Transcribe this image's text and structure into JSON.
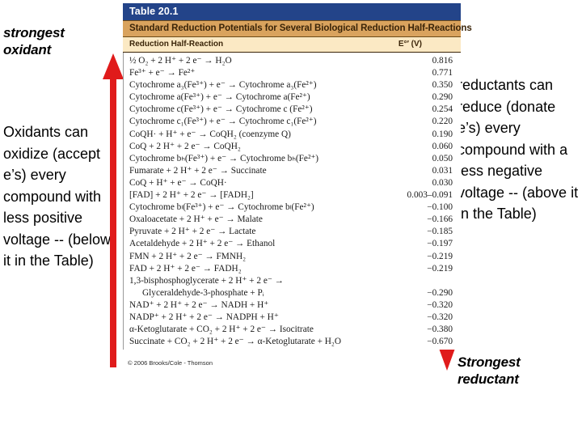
{
  "slide": {
    "left_caption": "strongest\noxidant",
    "left_body": "Oxidants can oxidize (accept e’s) every compound with less positive voltage -- (below it in the Table)",
    "right_body": "reductants can reduce (donate e’s) every compound with a less negative voltage -- (above it in the Table)",
    "right_caption": "Strongest\nreductant"
  },
  "arrows": {
    "left": {
      "name": "up-arrow",
      "direction": "up",
      "color": "#e01b1b"
    },
    "right": {
      "name": "down-arrow",
      "direction": "down",
      "color": "#e01b1b"
    }
  },
  "table": {
    "title": "Table 20.1",
    "subtitle": "Standard Reduction Potentials for Several Biological Reduction Half-Reactions",
    "col_reaction": "Reduction Half-Reaction",
    "col_potential": "E°′ (V)",
    "copyright": "© 2006 Brooks/Cole - Thomson",
    "colors": {
      "title_bg": "#234489",
      "subtitle_bg": "#d9a35e",
      "colhead_bg": "#fbe9c4",
      "accent_red": "#e01b1b"
    },
    "rows": [
      {
        "reaction": "½ O₂ + 2 H⁺ + 2 e⁻ → H₂O",
        "value": "0.816"
      },
      {
        "reaction": "Fe³⁺ + e⁻ → Fe²⁺",
        "value": "0.771"
      },
      {
        "reaction": "Cytochrome a₃(Fe³⁺) + e⁻ → Cytochrome a₃(Fe²⁺)",
        "value": "0.350"
      },
      {
        "reaction": "Cytochrome a(Fe³⁺) + e⁻ → Cytochrome a(Fe²⁺)",
        "value": "0.290"
      },
      {
        "reaction": "Cytochrome c(Fe³⁺) + e⁻ → Cytochrome c (Fe²⁺)",
        "value": "0.254"
      },
      {
        "reaction": "Cytochrome c₁(Fe³⁺) + e⁻ → Cytochrome c₁(Fe²⁺)",
        "value": "0.220"
      },
      {
        "reaction": "CoQH· + H⁺ + e⁻ → CoQH₂ (coenzyme Q)",
        "value": "0.190"
      },
      {
        "reaction": "CoQ + 2 H⁺ + 2 e⁻ → CoQH₂",
        "value": "0.060"
      },
      {
        "reaction": "Cytochrome bₕ(Fe³⁺) + e⁻ → Cytochrome bₕ(Fe²⁺)",
        "value": "0.050"
      },
      {
        "reaction": "Fumarate + 2 H⁺ + 2 e⁻ → Succinate",
        "value": "0.031"
      },
      {
        "reaction": "CoQ + H⁺ + e⁻ → CoQH·",
        "value": "0.030"
      },
      {
        "reaction": "[FAD] + 2 H⁺ + 2 e⁻ → [FADH₂]",
        "value": "0.003–0.091"
      },
      {
        "reaction": "Cytochrome bₗ(Fe³⁺) + e⁻ → Cytochrome bₗ(Fe²⁺)",
        "value": "−0.100"
      },
      {
        "reaction": "Oxaloacetate + 2 H⁺ + e⁻ → Malate",
        "value": "−0.166"
      },
      {
        "reaction": "Pyruvate + 2 H⁺ + 2 e⁻ → Lactate",
        "value": "−0.185"
      },
      {
        "reaction": "Acetaldehyde + 2 H⁺ + 2 e⁻ → Ethanol",
        "value": "−0.197"
      },
      {
        "reaction": "FMN + 2 H⁺ + 2 e⁻ → FMNH₂",
        "value": "−0.219"
      },
      {
        "reaction": "FAD + 2 H⁺ + 2 e⁻ → FADH₂",
        "value": "−0.219"
      },
      {
        "reaction": "1,3-bisphosphoglycerate + 2 H⁺ + 2 e⁻ →",
        "value": ""
      },
      {
        "reaction": "Glyceraldehyde-3-phosphate + Pᵢ",
        "value": "−0.290",
        "continuation": true
      },
      {
        "reaction": "NAD⁺ + 2 H⁺ + 2 e⁻ → NADH + H⁺",
        "value": "−0.320"
      },
      {
        "reaction": "NADP⁺ + 2 H⁺ + 2 e⁻ → NADPH + H⁺",
        "value": "−0.320"
      },
      {
        "reaction": "α-Ketoglutarate + CO₂ + 2 H⁺ + 2 e⁻ → Isocitrate",
        "value": "−0.380"
      },
      {
        "reaction": "Succinate + CO₂ + 2 H⁺ + 2 e⁻ → α-Ketoglutarate + H₂O",
        "value": "−0.670"
      }
    ]
  }
}
